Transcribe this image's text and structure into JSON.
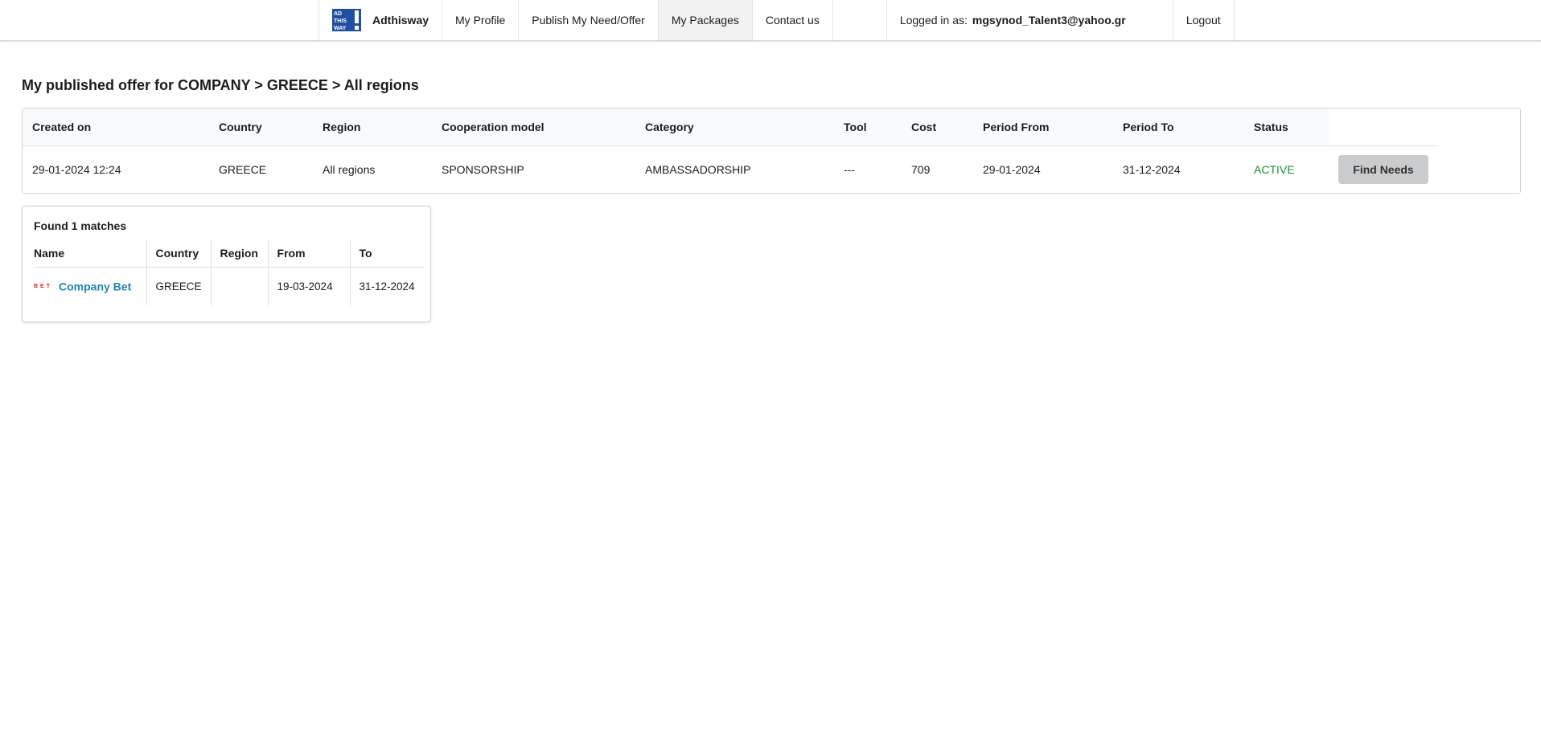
{
  "nav": {
    "logo_alt": "AD THIS WAY!",
    "brand": "Adthisway",
    "items": [
      {
        "label": "My Profile"
      },
      {
        "label": "Publish My Need/Offer"
      },
      {
        "label": "My Packages"
      },
      {
        "label": "Contact us"
      }
    ],
    "active_item": "My Packages",
    "logged_in_label": "Logged in as:",
    "logged_in_email": "mgsynod_Talent3@yahoo.gr",
    "logout_label": "Logout"
  },
  "page": {
    "title": "My published offer for COMPANY > GREECE > All regions"
  },
  "offer_table": {
    "headers": [
      "Created on",
      "Country",
      "Region",
      "Cooperation model",
      "Category",
      "Tool",
      "Cost",
      "Period From",
      "Period To",
      "Status"
    ],
    "row": {
      "created_on": "29-01-2024 12:24",
      "country": "GREECE",
      "region": "All regions",
      "cooperation_model": "SPONSORSHIP",
      "category": "AMBASSADORSHIP",
      "tool": "---",
      "cost": "709",
      "period_from": "29-01-2024",
      "period_to": "31-12-2024",
      "status": "ACTIVE",
      "status_color": "#1a8f2d"
    },
    "action_label": "Find Needs"
  },
  "matches": {
    "title": "Found 1 matches",
    "headers": [
      "Name",
      "Country",
      "Region",
      "From",
      "To"
    ],
    "rows": [
      {
        "logo_text": "BET",
        "name": "Company Bet",
        "country": "GREECE",
        "region": "",
        "from": "19-03-2024",
        "to": "31-12-2024"
      }
    ]
  },
  "colors": {
    "link": "#2185b0",
    "logo_blue": "#1f4fa1",
    "company_logo_red": "#e02020",
    "button_bg": "#cacbcd"
  }
}
